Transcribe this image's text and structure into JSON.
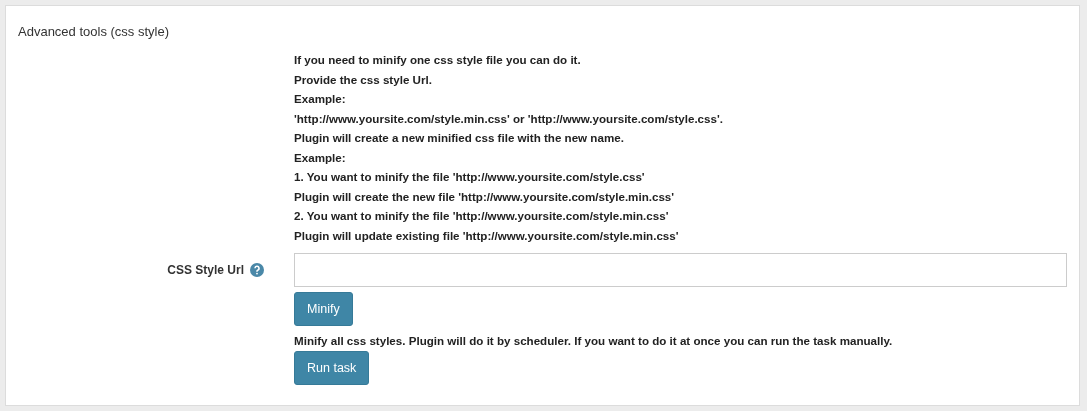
{
  "panel": {
    "title": "Advanced tools (css style)"
  },
  "instructions": [
    "If you need to minify one css style file you can do it.",
    "Provide the css style Url.",
    "Example:",
    "'http://www.yoursite.com/style.min.css' or 'http://www.yoursite.com/style.css'.",
    "Plugin will create a new minified css file with the new name.",
    "Example:",
    "1. You want to minify the file 'http://www.yoursite.com/style.css'",
    "Plugin will create the new file 'http://www.yoursite.com/style.min.css'",
    "2. You want to minify the file 'http://www.yoursite.com/style.min.css'",
    "Plugin will update existing file 'http://www.yoursite.com/style.min.css'"
  ],
  "url_field": {
    "label": "CSS Style Url",
    "has_help": true
  },
  "minify_button": "Minify",
  "task_note": "Minify all css styles. Plugin will do it by scheduler. If you want to do it at once you can run the task manually.",
  "run_button": "Run task"
}
